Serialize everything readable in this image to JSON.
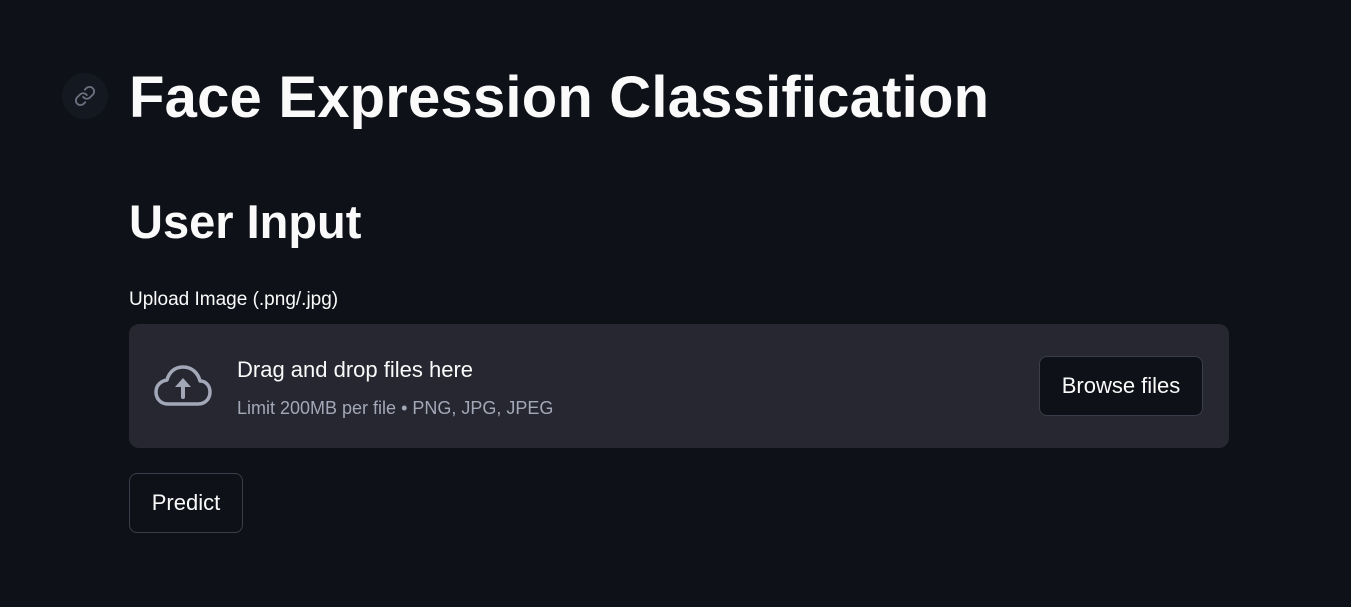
{
  "header": {
    "title": "Face Expression Classification",
    "anchor_icon": "link-icon"
  },
  "section": {
    "heading": "User Input"
  },
  "uploader": {
    "label": "Upload Image (.png/.jpg)",
    "icon": "cloud-upload-icon",
    "drop_text": "Drag and drop files here",
    "limit_text": "Limit 200MB per file • PNG, JPG, JPEG",
    "browse_label": "Browse files"
  },
  "actions": {
    "predict_label": "Predict"
  },
  "colors": {
    "background": "#0e1117",
    "dropzone": "#262730",
    "text": "#fafafa",
    "muted_text": "#a3a8b8",
    "border": "#3b3e4a"
  }
}
